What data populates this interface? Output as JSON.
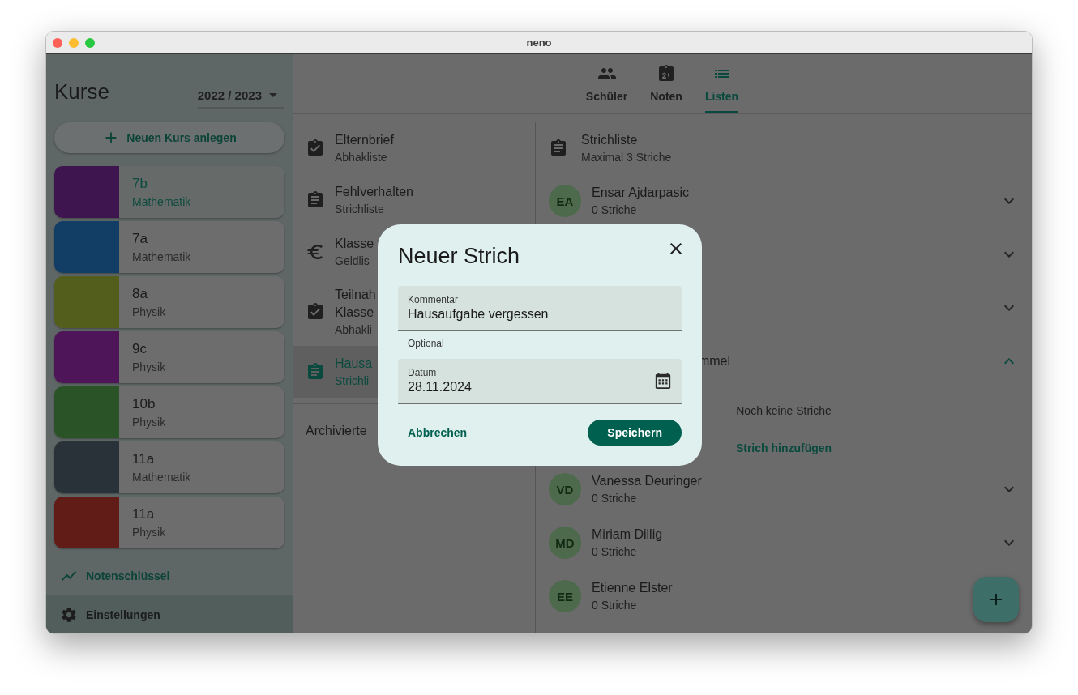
{
  "window": {
    "title": "neno"
  },
  "sidebar": {
    "title": "Kurse",
    "year": "2022 / 2023",
    "add_button": "Neuen Kurs anlegen",
    "courses": [
      {
        "name": "7b",
        "subject": "Mathematik",
        "color": "#3f1550",
        "selected": true
      },
      {
        "name": "7a",
        "subject": "Mathematik",
        "color": "#123e66",
        "selected": false
      },
      {
        "name": "8a",
        "subject": "Physik",
        "color": "#535e1c",
        "selected": false
      },
      {
        "name": "9c",
        "subject": "Physik",
        "color": "#4e1558",
        "selected": false
      },
      {
        "name": "10b",
        "subject": "Physik",
        "color": "#2a5428",
        "selected": false
      },
      {
        "name": "11a",
        "subject": "Mathematik",
        "color": "#283238",
        "selected": false
      },
      {
        "name": "11a",
        "subject": "Physik",
        "color": "#621c17",
        "selected": false
      }
    ],
    "links": [
      {
        "label": "Notenschlüssel",
        "kind": "chart",
        "selected": false
      },
      {
        "label": "Einstellungen",
        "kind": "gear",
        "selected": true
      }
    ]
  },
  "tabs": [
    {
      "label": "Schüler",
      "kind": "people",
      "selected": false
    },
    {
      "label": "Noten",
      "kind": "grade",
      "selected": false
    },
    {
      "label": "Listen",
      "kind": "list",
      "selected": true
    }
  ],
  "lists": [
    {
      "title": "Elternbrief",
      "subtitle": "Abhakliste",
      "kind": "check",
      "selected": false
    },
    {
      "title": "Fehlverhalten",
      "subtitle": "Strichliste",
      "kind": "tally",
      "selected": false
    },
    {
      "title": "Klasse",
      "subtitle": "Geldlis",
      "kind": "money",
      "selected": false
    },
    {
      "title": "Teilnah",
      "title_2": "Klasse",
      "subtitle": "Abhakli",
      "kind": "check",
      "selected": false
    },
    {
      "title": "Hausa",
      "subtitle": "Strichli",
      "kind": "tally",
      "selected": true
    }
  ],
  "archived_label": "Archivierte",
  "detail": {
    "title": "Strichliste",
    "subtitle": "Maximal 3 Striche",
    "students": [
      {
        "initials": "EA",
        "name": "Ensar Ajdarpasic",
        "count": "0 Striche",
        "expanded": false
      },
      {
        "expanded": false
      },
      {
        "expanded": false
      },
      {
        "name": "mmel",
        "expanded": true,
        "empty_text": "Noch keine Striche",
        "add_label": "Strich hinzufügen"
      },
      {
        "initials": "VD",
        "name": "Vanessa Deuringer",
        "count": "0 Striche",
        "expanded": false
      },
      {
        "initials": "MD",
        "name": "Miriam Dillig",
        "count": "0 Striche",
        "expanded": false
      },
      {
        "initials": "EE",
        "name": "Etienne Elster",
        "count": "0 Striche"
      }
    ]
  },
  "dialog": {
    "title": "Neuer Strich",
    "fields": [
      {
        "label": "Kommentar",
        "value": "Hausaufgabe vergessen",
        "helper": "Optional",
        "kind": "text"
      },
      {
        "label": "Datum",
        "value": "28.11.2024",
        "kind": "date"
      }
    ],
    "cancel": "Abbrechen",
    "save": "Speichern"
  }
}
